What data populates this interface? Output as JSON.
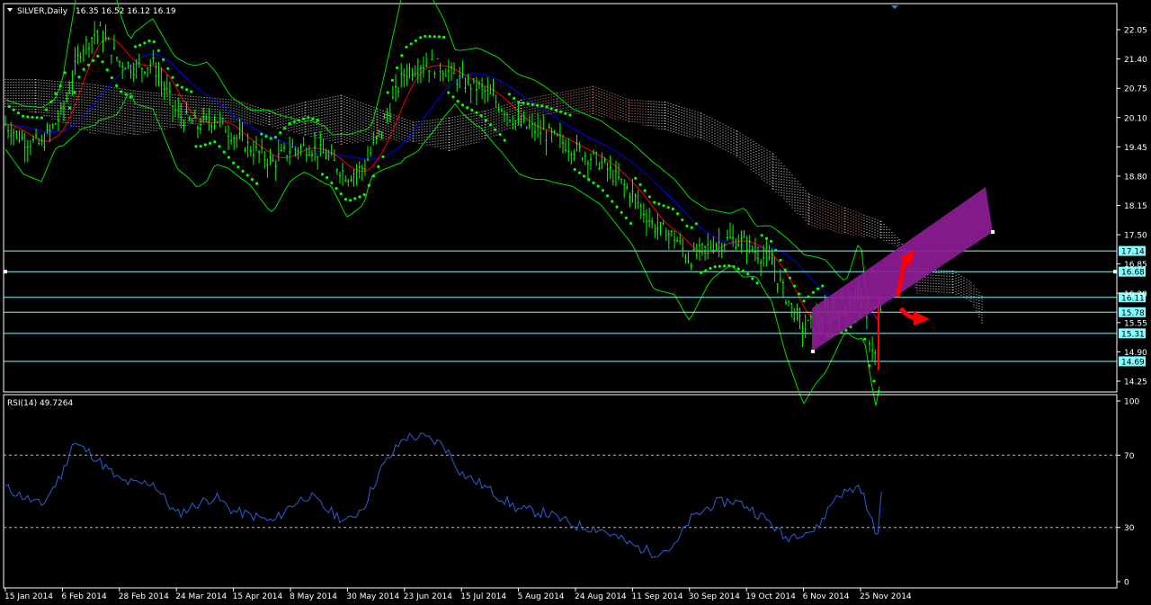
{
  "header": {
    "symbol": "SILVER,Daily",
    "ohlc": "16.35 16.52 16.12 16.19"
  },
  "rsi_header": "RSI(14) 49.7264",
  "colors": {
    "background": "#000000",
    "frame": "#ffffff",
    "candles": "#00ff00",
    "sar": "#00ff00",
    "bollinger": "#00dd00",
    "ma_red": "#ff0000",
    "ma_blue": "#0000ff",
    "cloud": "#ffffff",
    "level": "#7fffff",
    "rsi": "#2a5fd8",
    "channel": "#8e1c96",
    "arrow": "#ff0000"
  },
  "chart_data": [
    {
      "type": "line",
      "title": "SILVER,Daily",
      "indicators": [
        "Ichimoku cloud",
        "Bollinger Bands",
        "Parabolic SAR",
        "Moving averages"
      ],
      "x_axis": [
        "15 Jan 2014",
        "6 Feb 2014",
        "28 Feb 2014",
        "24 Mar 2014",
        "15 Apr 2014",
        "8 May 2014",
        "30 May 2014",
        "23 Jun 2014",
        "15 Jul 2014",
        "5 Aug 2014",
        "24 Aug 2014",
        "11 Sep 2014",
        "30 Sep 2014",
        "19 Oct 2014",
        "6 Nov 2014",
        "25 Nov 2014"
      ],
      "y_ticks": [
        "22.05",
        "21.40",
        "20.75",
        "20.10",
        "19.45",
        "18.80",
        "18.15",
        "17.50",
        "16.85",
        "16.20",
        "15.55",
        "14.90",
        "14.25"
      ],
      "ylim": [
        14.2,
        22.4
      ],
      "levels": [
        {
          "label": "17.14",
          "value": 17.14
        },
        {
          "label": "16.68",
          "value": 16.68
        },
        {
          "label": "16.11",
          "value": 16.11
        },
        {
          "label": "15.78",
          "value": 15.78
        },
        {
          "label": "15.31",
          "value": 15.31
        },
        {
          "label": "14.69",
          "value": 14.69
        }
      ],
      "close_path": [
        [
          "15 Jan 2014",
          19.95
        ],
        [
          "22 Jan 2014",
          19.6
        ],
        [
          "29 Jan 2014",
          19.5
        ],
        [
          "6 Feb 2014",
          20.2
        ],
        [
          "13 Feb 2014",
          21.6
        ],
        [
          "20 Feb 2014",
          22.05
        ],
        [
          "28 Feb 2014",
          21.35
        ],
        [
          "7 Mar 2014",
          21.2
        ],
        [
          "14 Mar 2014",
          21.3
        ],
        [
          "24 Mar 2014",
          20.2
        ],
        [
          "1 Apr 2014",
          19.9
        ],
        [
          "8 Apr 2014",
          20.1
        ],
        [
          "15 Apr 2014",
          19.7
        ],
        [
          "24 Apr 2014",
          19.35
        ],
        [
          "1 May 2014",
          19.1
        ],
        [
          "8 May 2014",
          19.4
        ],
        [
          "15 May 2014",
          19.45
        ],
        [
          "22 May 2014",
          19.25
        ],
        [
          "30 May 2014",
          18.8
        ],
        [
          "6 Jun 2014",
          19.0
        ],
        [
          "13 Jun 2014",
          19.8
        ],
        [
          "23 Jun 2014",
          21.1
        ],
        [
          "30 Jun 2014",
          21.3
        ],
        [
          "8 Jul 2014",
          21.2
        ],
        [
          "15 Jul 2014",
          20.9
        ],
        [
          "22 Jul 2014",
          20.75
        ],
        [
          "29 Jul 2014",
          20.4
        ],
        [
          "5 Aug 2014",
          19.95
        ],
        [
          "14 Aug 2014",
          19.75
        ],
        [
          "24 Aug 2014",
          19.4
        ],
        [
          "1 Sep 2014",
          19.1
        ],
        [
          "11 Sep 2014",
          18.4
        ],
        [
          "18 Sep 2014",
          17.7
        ],
        [
          "25 Sep 2014",
          17.45
        ],
        [
          "30 Sep 2014",
          16.95
        ],
        [
          "8 Oct 2014",
          17.3
        ],
        [
          "14 Oct 2014",
          17.4
        ],
        [
          "19 Oct 2014",
          17.3
        ],
        [
          "27 Oct 2014",
          16.85
        ],
        [
          "31 Oct 2014",
          16.2
        ],
        [
          "6 Nov 2014",
          15.4
        ],
        [
          "10 Nov 2014",
          15.6
        ],
        [
          "17 Nov 2014",
          15.8
        ],
        [
          "21 Nov 2014",
          15.95
        ],
        [
          "25 Nov 2014",
          16.3
        ],
        [
          "28 Nov 2014",
          15.2
        ],
        [
          "1 Dec 2014",
          14.6
        ],
        [
          "2 Dec 2014",
          16.19
        ]
      ]
    },
    {
      "type": "line",
      "title": "RSI(14) 49.7264",
      "y_ticks": [
        "100",
        "70",
        "30",
        "0"
      ],
      "ylim": [
        0,
        100
      ],
      "levels": [
        70,
        30
      ],
      "series": [
        {
          "values": [
            [
              "15 Jan 2014",
              52
            ],
            [
              "22 Jan 2014",
              47
            ],
            [
              "29 Jan 2014",
              42
            ],
            [
              "6 Feb 2014",
              60
            ],
            [
              "10 Feb 2014",
              77
            ],
            [
              "17 Feb 2014",
              71
            ],
            [
              "28 Feb 2014",
              56
            ],
            [
              "7 Mar 2014",
              54
            ],
            [
              "14 Mar 2014",
              55
            ],
            [
              "24 Mar 2014",
              37
            ],
            [
              "1 Apr 2014",
              43
            ],
            [
              "8 Apr 2014",
              47
            ],
            [
              "15 Apr 2014",
              39
            ],
            [
              "24 Apr 2014",
              36
            ],
            [
              "1 May 2014",
              33
            ],
            [
              "8 May 2014",
              42
            ],
            [
              "15 May 2014",
              48
            ],
            [
              "22 May 2014",
              40
            ],
            [
              "30 May 2014",
              33
            ],
            [
              "6 Jun 2014",
              42
            ],
            [
              "13 Jun 2014",
              62
            ],
            [
              "23 Jun 2014",
              80
            ],
            [
              "30 Jun 2014",
              80
            ],
            [
              "8 Jul 2014",
              76
            ],
            [
              "15 Jul 2014",
              60
            ],
            [
              "22 Jul 2014",
              54
            ],
            [
              "29 Jul 2014",
              47
            ],
            [
              "5 Aug 2014",
              40
            ],
            [
              "14 Aug 2014",
              38
            ],
            [
              "24 Aug 2014",
              31
            ],
            [
              "1 Sep 2014",
              29
            ],
            [
              "11 Sep 2014",
              20
            ],
            [
              "18 Sep 2014",
              16
            ],
            [
              "25 Sep 2014",
              19
            ],
            [
              "30 Sep 2014",
              34
            ],
            [
              "8 Oct 2014",
              43
            ],
            [
              "14 Oct 2014",
              45
            ],
            [
              "19 Oct 2014",
              42
            ],
            [
              "27 Oct 2014",
              32
            ],
            [
              "31 Oct 2014",
              24
            ],
            [
              "6 Nov 2014",
              28
            ],
            [
              "10 Nov 2014",
              28
            ],
            [
              "17 Nov 2014",
              48
            ],
            [
              "21 Nov 2014",
              50
            ],
            [
              "25 Nov 2014",
              53
            ],
            [
              "28 Nov 2014",
              36
            ],
            [
              "1 Dec 2014",
              25
            ],
            [
              "2 Dec 2014",
              49.7
            ]
          ]
        }
      ]
    }
  ]
}
